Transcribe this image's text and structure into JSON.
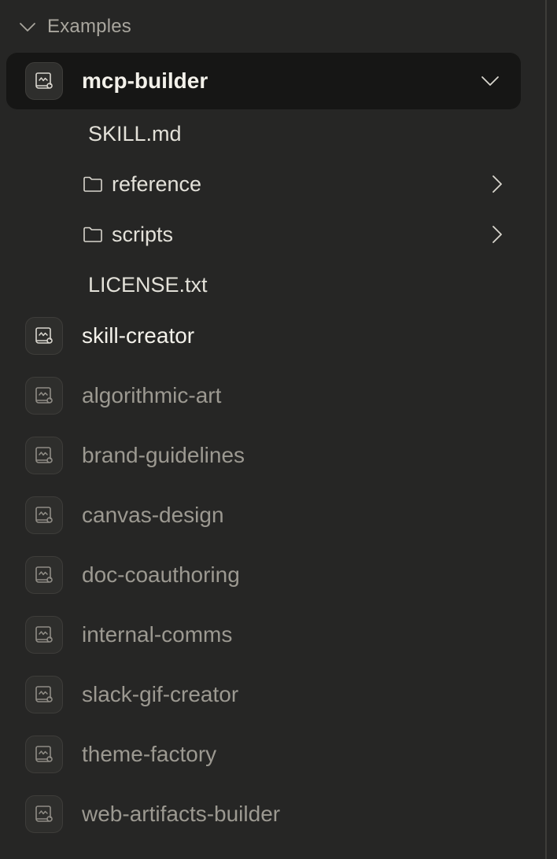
{
  "section": {
    "label": "Examples",
    "expanded": true
  },
  "skills": [
    {
      "label": "mcp-builder",
      "selected": true,
      "expanded": true
    },
    {
      "label": "skill-creator",
      "selected": false,
      "expanded": false
    },
    {
      "label": "algorithmic-art",
      "selected": false,
      "expanded": false
    },
    {
      "label": "brand-guidelines",
      "selected": false,
      "expanded": false
    },
    {
      "label": "canvas-design",
      "selected": false,
      "expanded": false
    },
    {
      "label": "doc-coauthoring",
      "selected": false,
      "expanded": false
    },
    {
      "label": "internal-comms",
      "selected": false,
      "expanded": false
    },
    {
      "label": "slack-gif-creator",
      "selected": false,
      "expanded": false
    },
    {
      "label": "theme-factory",
      "selected": false,
      "expanded": false
    },
    {
      "label": "web-artifacts-builder",
      "selected": false,
      "expanded": false
    }
  ],
  "files": [
    {
      "label": "SKILL.md",
      "type": "file"
    },
    {
      "label": "reference",
      "type": "folder"
    },
    {
      "label": "scripts",
      "type": "folder"
    },
    {
      "label": "LICENSE.txt",
      "type": "file"
    }
  ],
  "colors": {
    "background": "#262625",
    "selected_row": "#161615",
    "text_primary": "#f3f1ea",
    "text_dim": "#9c9991"
  },
  "icons": {
    "section_toggle": "chevron-down-icon",
    "skill": "scroll-icon",
    "folder": "folder-icon",
    "expand": "chevron-right-icon"
  }
}
